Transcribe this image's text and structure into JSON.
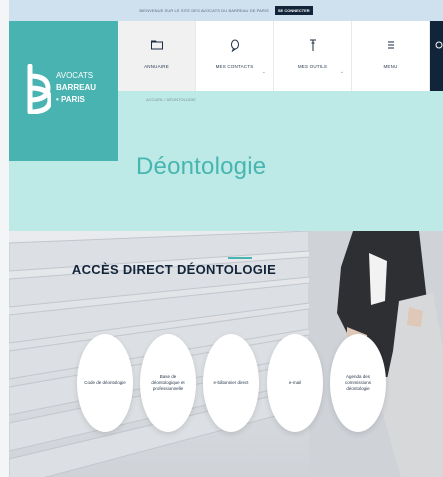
{
  "topbar": {
    "message": "BIENVENUE SUR LE SITE DES AVOCATS DU BARREAU DE PARIS",
    "button": "SE CONNECTER"
  },
  "logo": {
    "line1": "AVOCATS",
    "line2": "BARREAU",
    "line3": "• PARIS",
    "icon": "b-monogram-icon"
  },
  "nav": {
    "items": [
      {
        "label": "ANNUAIRE",
        "icon": "folder-icon",
        "active": true,
        "chevron": false
      },
      {
        "label": "MES CONTACTS",
        "icon": "chat-icon",
        "active": false,
        "chevron": true
      },
      {
        "label": "MES OUTILS",
        "icon": "tools-icon",
        "active": false,
        "chevron": true
      },
      {
        "label": "MENU",
        "icon": "hamburger-icon",
        "active": false,
        "chevron": false
      }
    ]
  },
  "breadcrumb": {
    "text": "ACCUEIL  /  DÉONTOLOGIE"
  },
  "page": {
    "title": "Déontologie"
  },
  "direct_access": {
    "title": "ACCÈS DIRECT DÉONTOLOGIE",
    "items": [
      {
        "label": "Code de déontologie"
      },
      {
        "label": "Base de déontologique et professionnelle"
      },
      {
        "label": "e-bâtonnier direct"
      },
      {
        "label": "e-mail"
      },
      {
        "label": "Agenda des commissions déontologie"
      }
    ]
  },
  "colors": {
    "teal": "#48b3b1",
    "light_teal": "#bde9e6",
    "navy": "#12243a"
  }
}
